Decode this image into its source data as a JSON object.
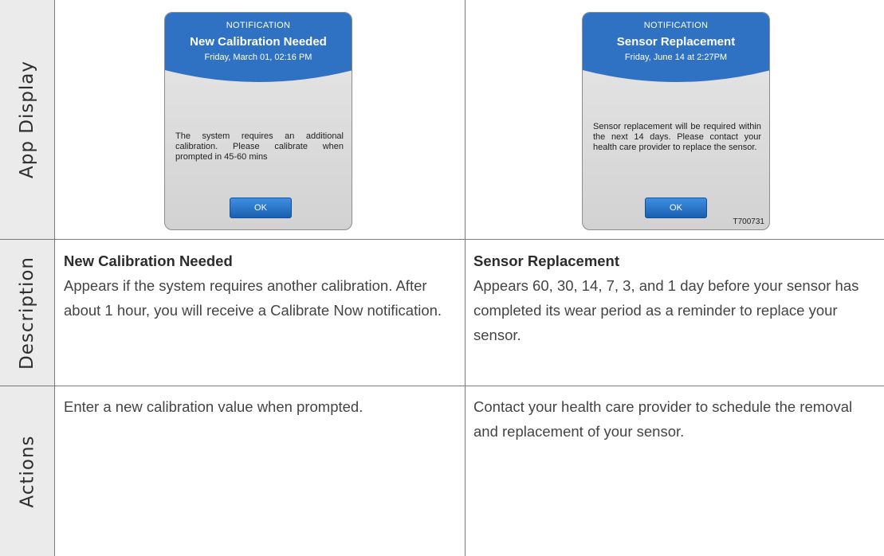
{
  "rows": {
    "app_display": "App Display",
    "description": "Description",
    "actions": "Actions"
  },
  "left": {
    "notification": {
      "kicker": "NOTIFICATION",
      "title": "New Calibration Needed",
      "datetime": "Friday, March 01, 02:16 PM",
      "message": "The system requires an additional calibration. Please calibrate when prompted in 45-60 mins",
      "ok_label": "OK"
    },
    "description": {
      "heading": "New Calibration Needed",
      "text": "Appears if the system requires another calibration. After about 1 hour, you will receive a Calibrate Now notification."
    },
    "action": "Enter a new calibration value when prompted."
  },
  "right": {
    "notification": {
      "kicker": "NOTIFICATION",
      "title": "Sensor Replacement",
      "datetime": "Friday, June 14 at 2:27PM",
      "message": "Sensor replacement will be required within the next 14 days. Please contact your health care provider to replace the sensor.",
      "ok_label": "OK",
      "figure_code": "T700731"
    },
    "description": {
      "heading": "Sensor Replacement",
      "text": "Appears 60, 30, 14, 7, 3, and 1 day before your sensor has completed its wear period as a reminder to replace your sensor."
    },
    "action": "Contact your health care provider to schedule the removal and replacement of your sensor."
  },
  "colors": {
    "header_blue": "#2f72c4",
    "button_blue": "#2a77cc",
    "row_header_bg": "#ebebeb"
  }
}
